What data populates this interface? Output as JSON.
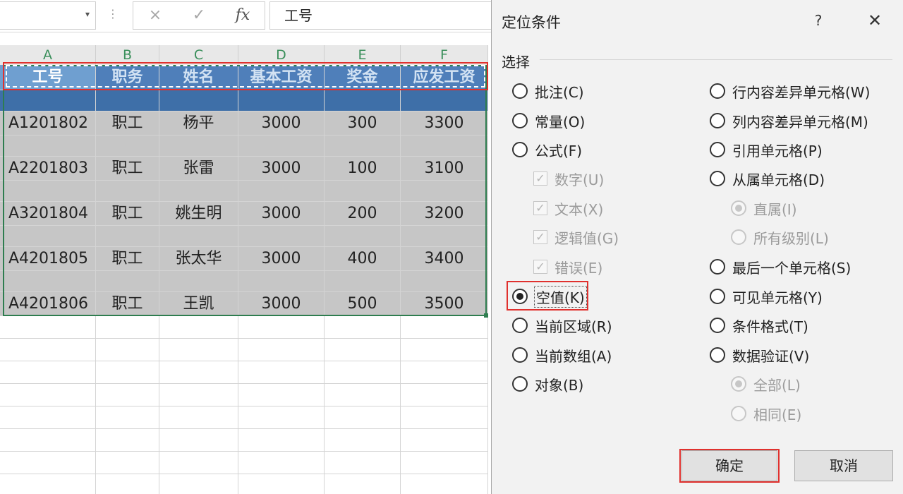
{
  "formula_bar": {
    "name_box_value": "",
    "cancel_icon": "×",
    "enter_icon": "✓",
    "fx_label": "fx",
    "formula_value": "工号"
  },
  "grid": {
    "columns": [
      "A",
      "B",
      "C",
      "D",
      "E",
      "F"
    ],
    "header_row": [
      "工号",
      "职务",
      "姓名",
      "基本工资",
      "奖金",
      "应发工资"
    ],
    "rows": [
      [
        "A1201802",
        "职工",
        "杨平",
        "3000",
        "300",
        "3300"
      ],
      [
        "A2201803",
        "职工",
        "张雷",
        "3000",
        "100",
        "3100"
      ],
      [
        "A3201804",
        "职工",
        "姚生明",
        "3000",
        "200",
        "3200"
      ],
      [
        "A4201805",
        "职工",
        "张太华",
        "3000",
        "400",
        "3400"
      ],
      [
        "A4201806",
        "职工",
        "王凯",
        "3000",
        "500",
        "3500"
      ]
    ]
  },
  "dialog": {
    "title": "定位条件",
    "help": "?",
    "close": "✕",
    "group_label": "选择",
    "left_options": [
      {
        "label": "批注(C)",
        "type": "radio",
        "checked": false,
        "disabled": false
      },
      {
        "label": "常量(O)",
        "type": "radio",
        "checked": false,
        "disabled": false
      },
      {
        "label": "公式(F)",
        "type": "radio",
        "checked": false,
        "disabled": false
      },
      {
        "label": "数字(U)",
        "type": "checkbox",
        "checked": true,
        "disabled": true
      },
      {
        "label": "文本(X)",
        "type": "checkbox",
        "checked": true,
        "disabled": true
      },
      {
        "label": "逻辑值(G)",
        "type": "checkbox",
        "checked": true,
        "disabled": true
      },
      {
        "label": "错误(E)",
        "type": "checkbox",
        "checked": true,
        "disabled": true
      },
      {
        "label": "空值(K)",
        "type": "radio",
        "checked": true,
        "disabled": false
      },
      {
        "label": "当前区域(R)",
        "type": "radio",
        "checked": false,
        "disabled": false
      },
      {
        "label": "当前数组(A)",
        "type": "radio",
        "checked": false,
        "disabled": false
      },
      {
        "label": "对象(B)",
        "type": "radio",
        "checked": false,
        "disabled": false
      }
    ],
    "right_options": [
      {
        "label": "行内容差异单元格(W)",
        "type": "radio",
        "checked": false,
        "disabled": false
      },
      {
        "label": "列内容差异单元格(M)",
        "type": "radio",
        "checked": false,
        "disabled": false
      },
      {
        "label": "引用单元格(P)",
        "type": "radio",
        "checked": false,
        "disabled": false
      },
      {
        "label": "从属单元格(D)",
        "type": "radio",
        "checked": false,
        "disabled": false
      },
      {
        "label": "直属(I)",
        "type": "radio",
        "checked": true,
        "disabled": true
      },
      {
        "label": "所有级别(L)",
        "type": "radio",
        "checked": false,
        "disabled": true
      },
      {
        "label": "最后一个单元格(S)",
        "type": "radio",
        "checked": false,
        "disabled": false
      },
      {
        "label": "可见单元格(Y)",
        "type": "radio",
        "checked": false,
        "disabled": false
      },
      {
        "label": "条件格式(T)",
        "type": "radio",
        "checked": false,
        "disabled": false
      },
      {
        "label": "数据验证(V)",
        "type": "radio",
        "checked": false,
        "disabled": false
      },
      {
        "label": "全部(L)",
        "type": "radio",
        "checked": true,
        "disabled": true
      },
      {
        "label": "相同(E)",
        "type": "radio",
        "checked": false,
        "disabled": true
      }
    ],
    "ok_label": "确定",
    "cancel_label": "取消"
  }
}
